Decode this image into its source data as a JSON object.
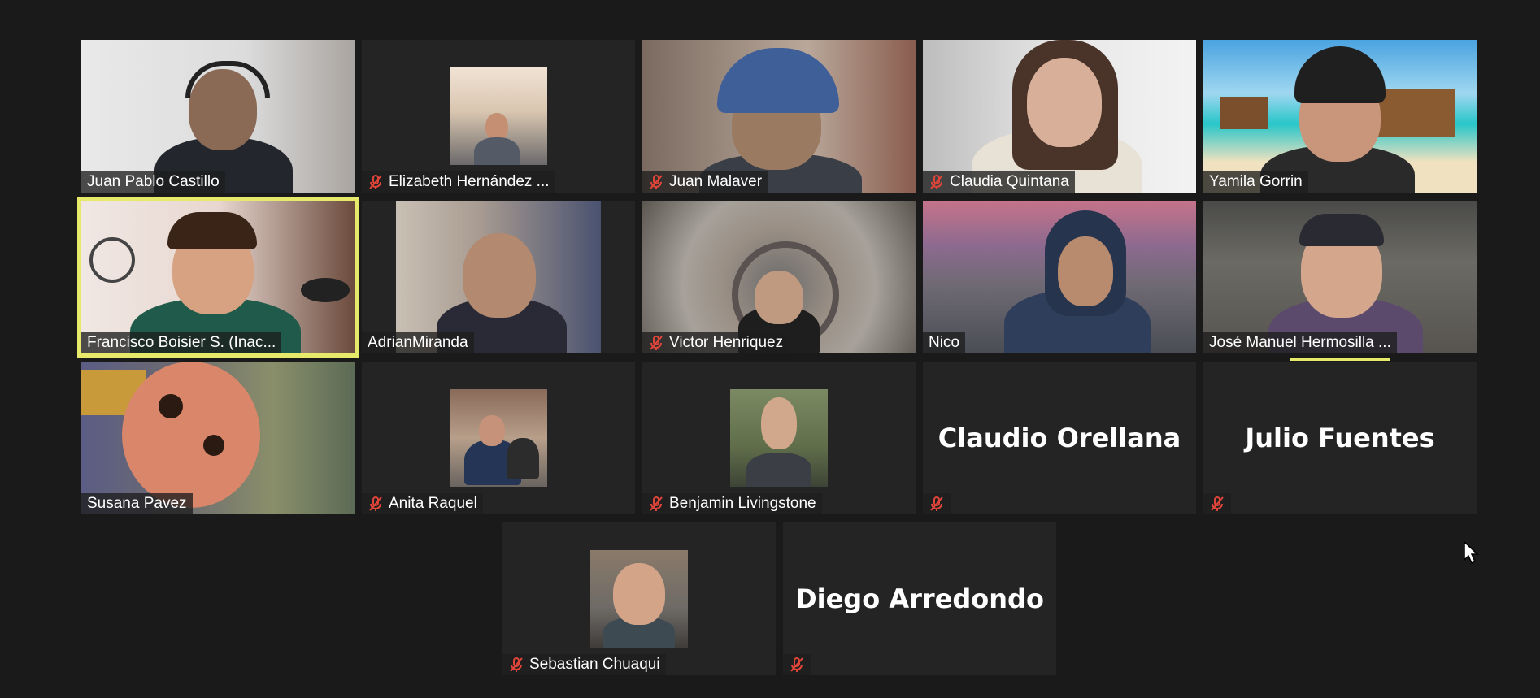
{
  "participants": [
    {
      "name": "Juan Pablo Castillo",
      "muted": false
    },
    {
      "name": "Elizabeth Hernández ...",
      "muted": true
    },
    {
      "name": "Juan Malaver",
      "muted": true
    },
    {
      "name": "Claudia Quintana",
      "muted": true
    },
    {
      "name": "Yamila Gorrin",
      "muted": false
    },
    {
      "name": "Francisco Boisier S. (Inac...",
      "muted": false
    },
    {
      "name": "AdrianMiranda",
      "muted": false
    },
    {
      "name": "Victor Henriquez",
      "muted": true
    },
    {
      "name": "Nico",
      "muted": false
    },
    {
      "name": "José Manuel Hermosilla ...",
      "muted": false
    },
    {
      "name": "Susana Pavez",
      "muted": false
    },
    {
      "name": "Anita Raquel",
      "muted": true
    },
    {
      "name": "Benjamin Livingstone",
      "muted": true
    },
    {
      "name": "Claudio Orellana",
      "muted": true
    },
    {
      "name": "Julio Fuentes",
      "muted": true
    },
    {
      "name": "Sebastian Chuaqui",
      "muted": true
    },
    {
      "name": "Diego Arredondo",
      "muted": true
    }
  ],
  "active_speaker": "Francisco Boisier S. (Inac...",
  "colors": {
    "background": "#1a1a1a",
    "tile": "#242424",
    "speaker_highlight": "#e7e96a",
    "mute_icon": "#e0453a"
  },
  "icons": {
    "mute": "microphone-muted-icon",
    "cursor": "mouse-pointer-icon"
  }
}
